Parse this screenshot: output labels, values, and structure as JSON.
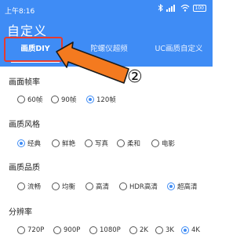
{
  "status_bar": {
    "time": "上午8:16",
    "icons": [
      "bluetooth-icon",
      "signal-icon",
      "wifi-icon",
      "battery-icon"
    ],
    "battery": "100"
  },
  "header": {
    "title": "自定义",
    "bg_color": "#3f8cf5"
  },
  "tabs": [
    {
      "label": "画质DIY",
      "active": true
    },
    {
      "label": "陀螺仪超频",
      "active": false
    },
    {
      "label": "UC画质自定义",
      "active": false
    }
  ],
  "annotation": {
    "number": "②",
    "arrow_color": "#f47a1f",
    "box_color": "#e53b2f"
  },
  "sections": [
    {
      "title": "画面帧率",
      "options": [
        {
          "label": "60帧",
          "checked": false
        },
        {
          "label": "90帧",
          "checked": false
        },
        {
          "label": "120帧",
          "checked": true
        }
      ]
    },
    {
      "title": "画质风格",
      "options": [
        {
          "label": "经典",
          "checked": true
        },
        {
          "label": "鲜艳",
          "checked": false
        },
        {
          "label": "写真",
          "checked": false
        },
        {
          "label": "柔和",
          "checked": false
        },
        {
          "label": "电影",
          "checked": false
        }
      ]
    },
    {
      "title": "画质品质",
      "options": [
        {
          "label": "流畅",
          "checked": false
        },
        {
          "label": "均衡",
          "checked": false
        },
        {
          "label": "高清",
          "checked": false
        },
        {
          "label": "HDR高清",
          "checked": false
        },
        {
          "label": "超高清",
          "checked": true
        }
      ]
    },
    {
      "title": "分辨率",
      "options": [
        {
          "label": "720P",
          "checked": false
        },
        {
          "label": "900P",
          "checked": false
        },
        {
          "label": "1080P",
          "checked": false
        },
        {
          "label": "2K",
          "checked": false
        },
        {
          "label": "3K",
          "checked": false
        },
        {
          "label": "4K",
          "checked": true
        }
      ]
    }
  ]
}
